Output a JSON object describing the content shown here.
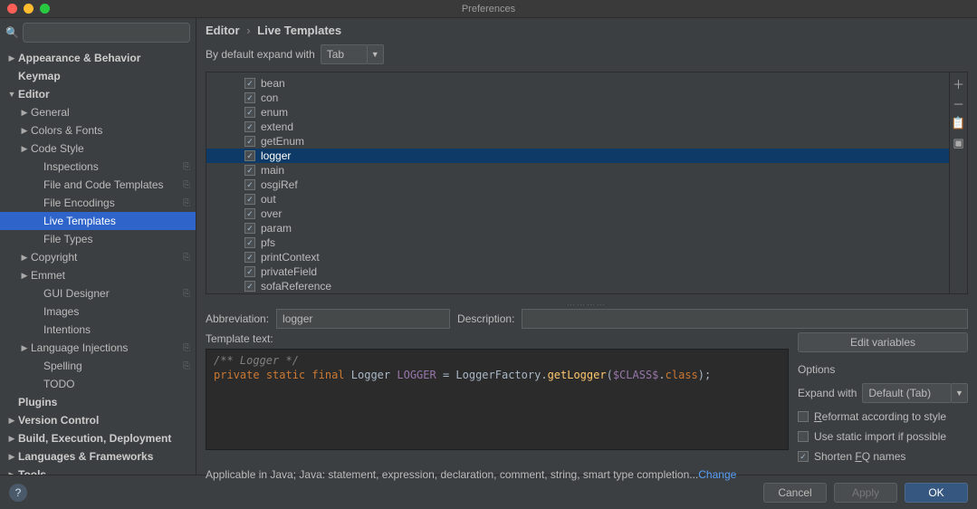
{
  "window": {
    "title": "Preferences"
  },
  "breadcrumb": {
    "parent": "Editor",
    "current": "Live Templates"
  },
  "sidebar": {
    "search_placeholder": "",
    "items": [
      {
        "label": "Appearance & Behavior",
        "arrow": "right",
        "depth": 0,
        "bold": true
      },
      {
        "label": "Keymap",
        "arrow": "none",
        "depth": 0,
        "bold": true
      },
      {
        "label": "Editor",
        "arrow": "down",
        "depth": 0,
        "bold": true
      },
      {
        "label": "General",
        "arrow": "right",
        "depth": 1
      },
      {
        "label": "Colors & Fonts",
        "arrow": "right",
        "depth": 1
      },
      {
        "label": "Code Style",
        "arrow": "right",
        "depth": 1
      },
      {
        "label": "Inspections",
        "arrow": "none",
        "depth": 2,
        "badge": true
      },
      {
        "label": "File and Code Templates",
        "arrow": "none",
        "depth": 2,
        "badge": true
      },
      {
        "label": "File Encodings",
        "arrow": "none",
        "depth": 2,
        "badge": true
      },
      {
        "label": "Live Templates",
        "arrow": "none",
        "depth": 2,
        "selected": true
      },
      {
        "label": "File Types",
        "arrow": "none",
        "depth": 2
      },
      {
        "label": "Copyright",
        "arrow": "right",
        "depth": 1,
        "badge": true
      },
      {
        "label": "Emmet",
        "arrow": "right",
        "depth": 1
      },
      {
        "label": "GUI Designer",
        "arrow": "none",
        "depth": 2,
        "badge": true
      },
      {
        "label": "Images",
        "arrow": "none",
        "depth": 2
      },
      {
        "label": "Intentions",
        "arrow": "none",
        "depth": 2
      },
      {
        "label": "Language Injections",
        "arrow": "right",
        "depth": 1,
        "badge": true
      },
      {
        "label": "Spelling",
        "arrow": "none",
        "depth": 2,
        "badge": true
      },
      {
        "label": "TODO",
        "arrow": "none",
        "depth": 2
      },
      {
        "label": "Plugins",
        "arrow": "none",
        "depth": 0,
        "bold": true
      },
      {
        "label": "Version Control",
        "arrow": "right",
        "depth": 0,
        "bold": true
      },
      {
        "label": "Build, Execution, Deployment",
        "arrow": "right",
        "depth": 0,
        "bold": true
      },
      {
        "label": "Languages & Frameworks",
        "arrow": "right",
        "depth": 0,
        "bold": true
      },
      {
        "label": "Tools",
        "arrow": "right",
        "depth": 0,
        "bold": true
      }
    ]
  },
  "expand": {
    "label": "By default expand with",
    "value": "Tab"
  },
  "templates": [
    {
      "name": "bean",
      "checked": true
    },
    {
      "name": "con",
      "checked": true
    },
    {
      "name": "enum",
      "checked": true
    },
    {
      "name": "extend",
      "checked": true
    },
    {
      "name": "getEnum",
      "checked": true
    },
    {
      "name": "logger",
      "checked": true,
      "selected": true
    },
    {
      "name": "main",
      "checked": true
    },
    {
      "name": "osgiRef",
      "checked": true
    },
    {
      "name": "out",
      "checked": true
    },
    {
      "name": "over",
      "checked": true
    },
    {
      "name": "param",
      "checked": true
    },
    {
      "name": "pfs",
      "checked": true
    },
    {
      "name": "printContext",
      "checked": true
    },
    {
      "name": "privateField",
      "checked": true
    },
    {
      "name": "sofaReference",
      "checked": true
    }
  ],
  "form": {
    "abbreviation_label": "Abbreviation:",
    "abbreviation_value": "logger",
    "description_label": "Description:",
    "description_value": "",
    "template_text_label": "Template text:",
    "code": {
      "comment": "/** Logger */",
      "kw_private": "private",
      "kw_static": "static",
      "kw_final": "final",
      "type": "Logger",
      "name1": "L",
      "name2": "OGGER",
      "eq": " = ",
      "factory": "LoggerFactory",
      "dot1": ".",
      "method": "getLogger",
      "paren_open": "(",
      "var": "$CLASS$",
      "dot2": ".",
      "klass": "class",
      "paren_close": ")",
      "semi": ";"
    }
  },
  "right": {
    "edit_variables": "Edit variables",
    "options_title": "Options",
    "expand_with_label": "Expand with",
    "expand_with_value": "Default (Tab)",
    "opt_reformat": "eformat according to style",
    "opt_reformat_prefix": "R",
    "opt_static": "Use static import if possible",
    "opt_shorten_prefix": "Shorten ",
    "opt_shorten_mnemonic": "F",
    "opt_shorten_suffix": "Q names",
    "reformat_checked": false,
    "static_checked": false,
    "shorten_checked": true
  },
  "applicable": {
    "text": "Applicable in Java; Java: statement, expression, declaration, comment, string, smart type completion...",
    "change": "Change"
  },
  "footer": {
    "cancel": "Cancel",
    "apply": "Apply",
    "ok": "OK"
  }
}
